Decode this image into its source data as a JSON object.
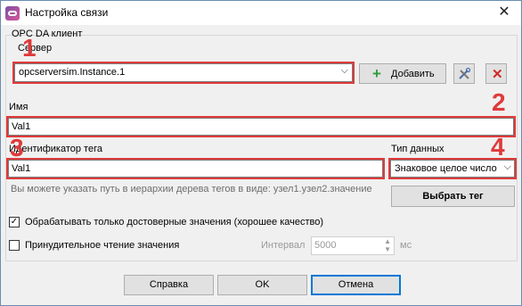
{
  "window": {
    "title": "Настройка связи"
  },
  "group": {
    "legend": "OPC DA клиент"
  },
  "server": {
    "label": "Сервер",
    "value": "opcserversim.Instance.1",
    "add_label": "Добавить",
    "badge": "1"
  },
  "name": {
    "label": "Имя",
    "value": "Val1",
    "badge": "2"
  },
  "tag": {
    "label": "Идентификатор тега",
    "value": "Val1",
    "badge": "3",
    "hint": "Вы можете указать путь в иерархии дерева тегов в виде: узел1.узел2.значение"
  },
  "datatype": {
    "label": "Тип данных",
    "value": "Знаковое целое число",
    "badge": "4"
  },
  "select_tag_label": "Выбрать тег",
  "options": {
    "reliable_only": {
      "label": "Обрабатывать только достоверные значения (хорошее качество)",
      "checked": true
    },
    "force_read": {
      "label": "Принудительное чтение значения",
      "checked": false
    }
  },
  "interval": {
    "label": "Интервал",
    "value": "5000",
    "unit": "мс"
  },
  "buttons": {
    "help": "Справка",
    "ok": "OK",
    "cancel": "Отмена"
  },
  "colors": {
    "annotation": "#e03a3a",
    "add_icon": "#2e9e3a",
    "delete_icon": "#d02828",
    "focus": "#0078d7"
  }
}
